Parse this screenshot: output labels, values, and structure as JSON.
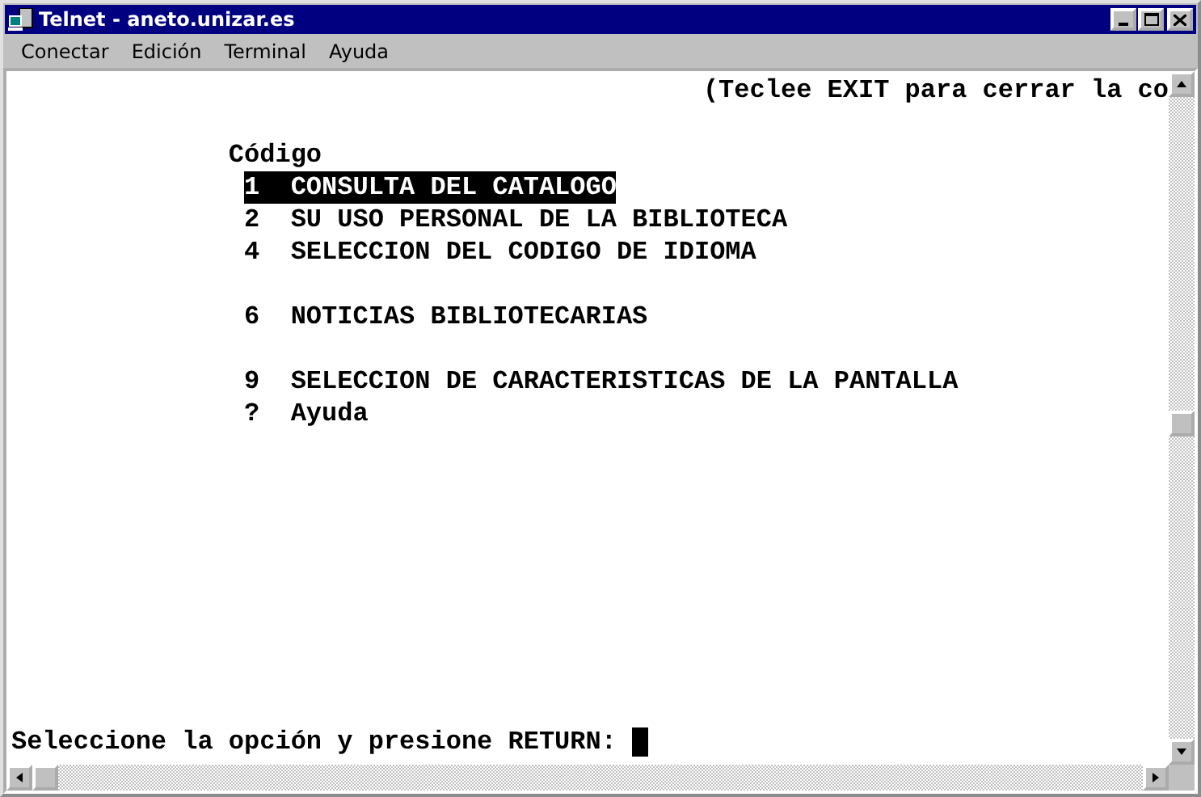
{
  "window": {
    "title": "Telnet - aneto.unizar.es"
  },
  "menu": [
    {
      "label": "Conectar"
    },
    {
      "label": "Edición"
    },
    {
      "label": "Terminal"
    },
    {
      "label": "Ayuda"
    }
  ],
  "terminal": {
    "header": "(Teclee EXIT para cerrar la co",
    "heading": "Código",
    "groups": [
      [
        {
          "key": "1",
          "label": "CONSULTA DEL CATALOGO",
          "selected": true
        },
        {
          "key": "2",
          "label": "SU USO PERSONAL DE LA BIBLIOTECA",
          "selected": false
        },
        {
          "key": "4",
          "label": "SELECCION DEL CODIGO DE IDIOMA",
          "selected": false
        }
      ],
      [
        {
          "key": "6",
          "label": "NOTICIAS BIBLIOTECARIAS",
          "selected": false
        }
      ],
      [
        {
          "key": "9",
          "label": "SELECCION DE CARACTERISTICAS DE LA PANTALLA",
          "selected": false
        },
        {
          "key": "?",
          "label": "Ayuda",
          "selected": false
        }
      ]
    ],
    "prompt": "Seleccione la opción y presione RETURN:"
  }
}
